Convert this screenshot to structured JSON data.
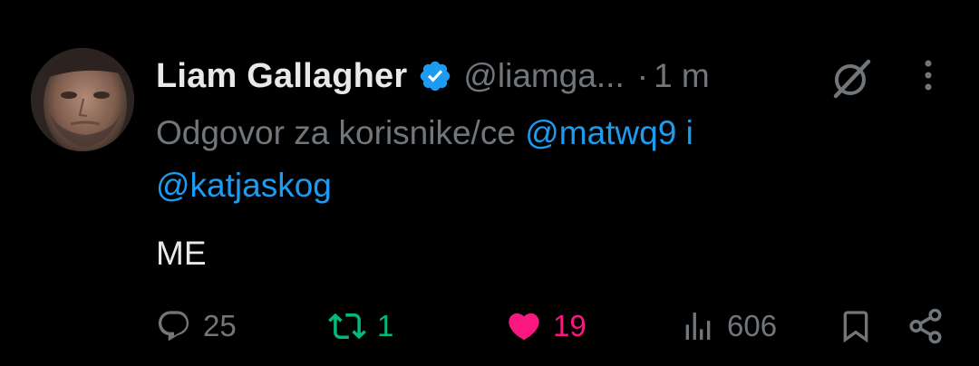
{
  "tweet": {
    "author": {
      "display_name": "Liam Gallagher",
      "handle": "@liamga...",
      "verified": true
    },
    "separator": "·",
    "time": "1 m",
    "reply_context": {
      "prefix": "Odgovor za korisnike/ce",
      "mention_1": "@matwq9",
      "joiner": "i",
      "mention_2": "@katjaskog"
    },
    "text": "ME",
    "stats": {
      "replies": "25",
      "retweets": "1",
      "likes": "19",
      "views": "606"
    },
    "liked": true,
    "retweeted": true
  },
  "colors": {
    "background": "#000000",
    "primary_text": "#e7e9ea",
    "secondary_text": "#71767b",
    "link": "#1d9bf0",
    "retweet": "#00ba7c",
    "like": "#f91880",
    "verified": "#1d9bf0"
  },
  "icons": {
    "verified": "verified-badge-icon",
    "grok": "grok-icon",
    "more": "more-vertical-icon",
    "reply": "reply-icon",
    "retweet": "retweet-icon",
    "like": "heart-icon",
    "views": "views-icon",
    "bookmark": "bookmark-icon",
    "share": "share-icon"
  }
}
